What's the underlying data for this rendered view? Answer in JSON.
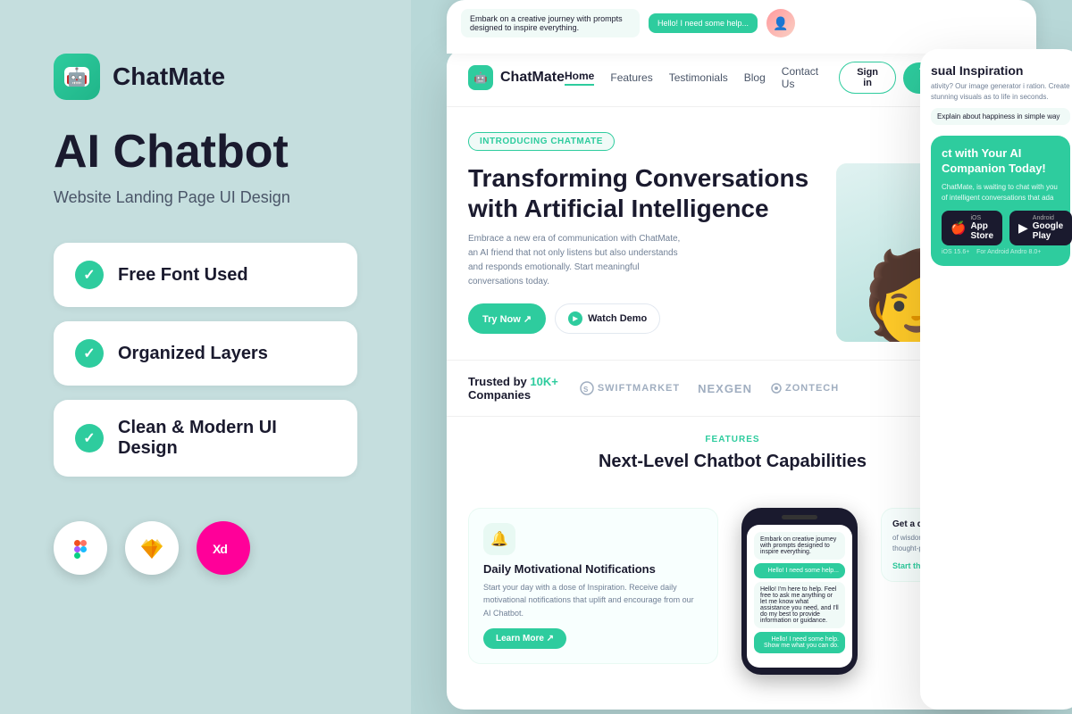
{
  "left": {
    "brand": "ChatMate",
    "title": "AI Chatbot",
    "subtitle": "Website Landing Page UI Design",
    "features": [
      {
        "id": "free-font",
        "label": "Free Font Used"
      },
      {
        "id": "organized-layers",
        "label": "Organized Layers"
      },
      {
        "id": "clean-ui",
        "label": "Clean & Modern UI Design"
      }
    ],
    "tools": [
      {
        "id": "figma",
        "icon": "Figma"
      },
      {
        "id": "sketch",
        "icon": "Sketch"
      },
      {
        "id": "xd",
        "icon": "Xd"
      }
    ]
  },
  "preview": {
    "nav": {
      "brand": "ChatMate",
      "links": [
        "Home",
        "Features",
        "Testimonials",
        "Blog",
        "Contact Us"
      ],
      "active_link": "Home",
      "signin_label": "Sign in",
      "try_label": "Try ChatMate ↗"
    },
    "hero": {
      "badge": "INTRODUCING CHATMATE",
      "title": "Transforming Conversations with Artificial Intelligence",
      "description": "Embrace a new era of communication with ChatMate, an AI friend that not only listens but also understands and responds emotionally. Start meaningful conversations today.",
      "btn_primary": "Try Now ↗",
      "btn_watch": "Watch Demo"
    },
    "trusted": {
      "label": "Trusted by",
      "count": "10K+",
      "suffix": "Companies",
      "logos": [
        "SwiftMarket",
        "NexGen",
        "ZonTech"
      ]
    },
    "features_section": {
      "badge": "FEATURES",
      "title": "Next-Level Chatbot Capabilities"
    },
    "feature_card": {
      "title": "Daily Motivational Notifications",
      "description": "Start your day with a dose of Inspiration. Receive daily motivational notifications that uplift and encourage from our AI Chatbot.",
      "btn_label": "Learn More ↗"
    },
    "side": {
      "bubble1": "Embark on a creative journey with prompts designed to inspire everything.",
      "bubble2": "Hello! I need some help...",
      "section_title": "ct with Your AI Companion Today!",
      "section_desc": "ChatMate, is waiting to chat with you of intelligent conversations that ada",
      "chat_helper": "Hello! I need some help. Show me what you can do.",
      "insight_title": "Get a daily Insight",
      "insight_desc": "of wisdom, humor, and thought-provoking questions.",
      "ios_label": "iOS 15.6+",
      "android_label": "For Android",
      "store_apple": "App Store",
      "store_google": "Google Play"
    },
    "visual_side": {
      "title": "sual Inspiration",
      "desc": "ativity? Our image generator i ration. Create stunning visuals as to life in seconds.",
      "chat1": "Explain about happiness in simple way"
    }
  },
  "colors": {
    "accent": "#2ecc9e",
    "dark": "#1a1a2e",
    "bg": "#c5dede",
    "light_bg": "#f0faf7"
  }
}
